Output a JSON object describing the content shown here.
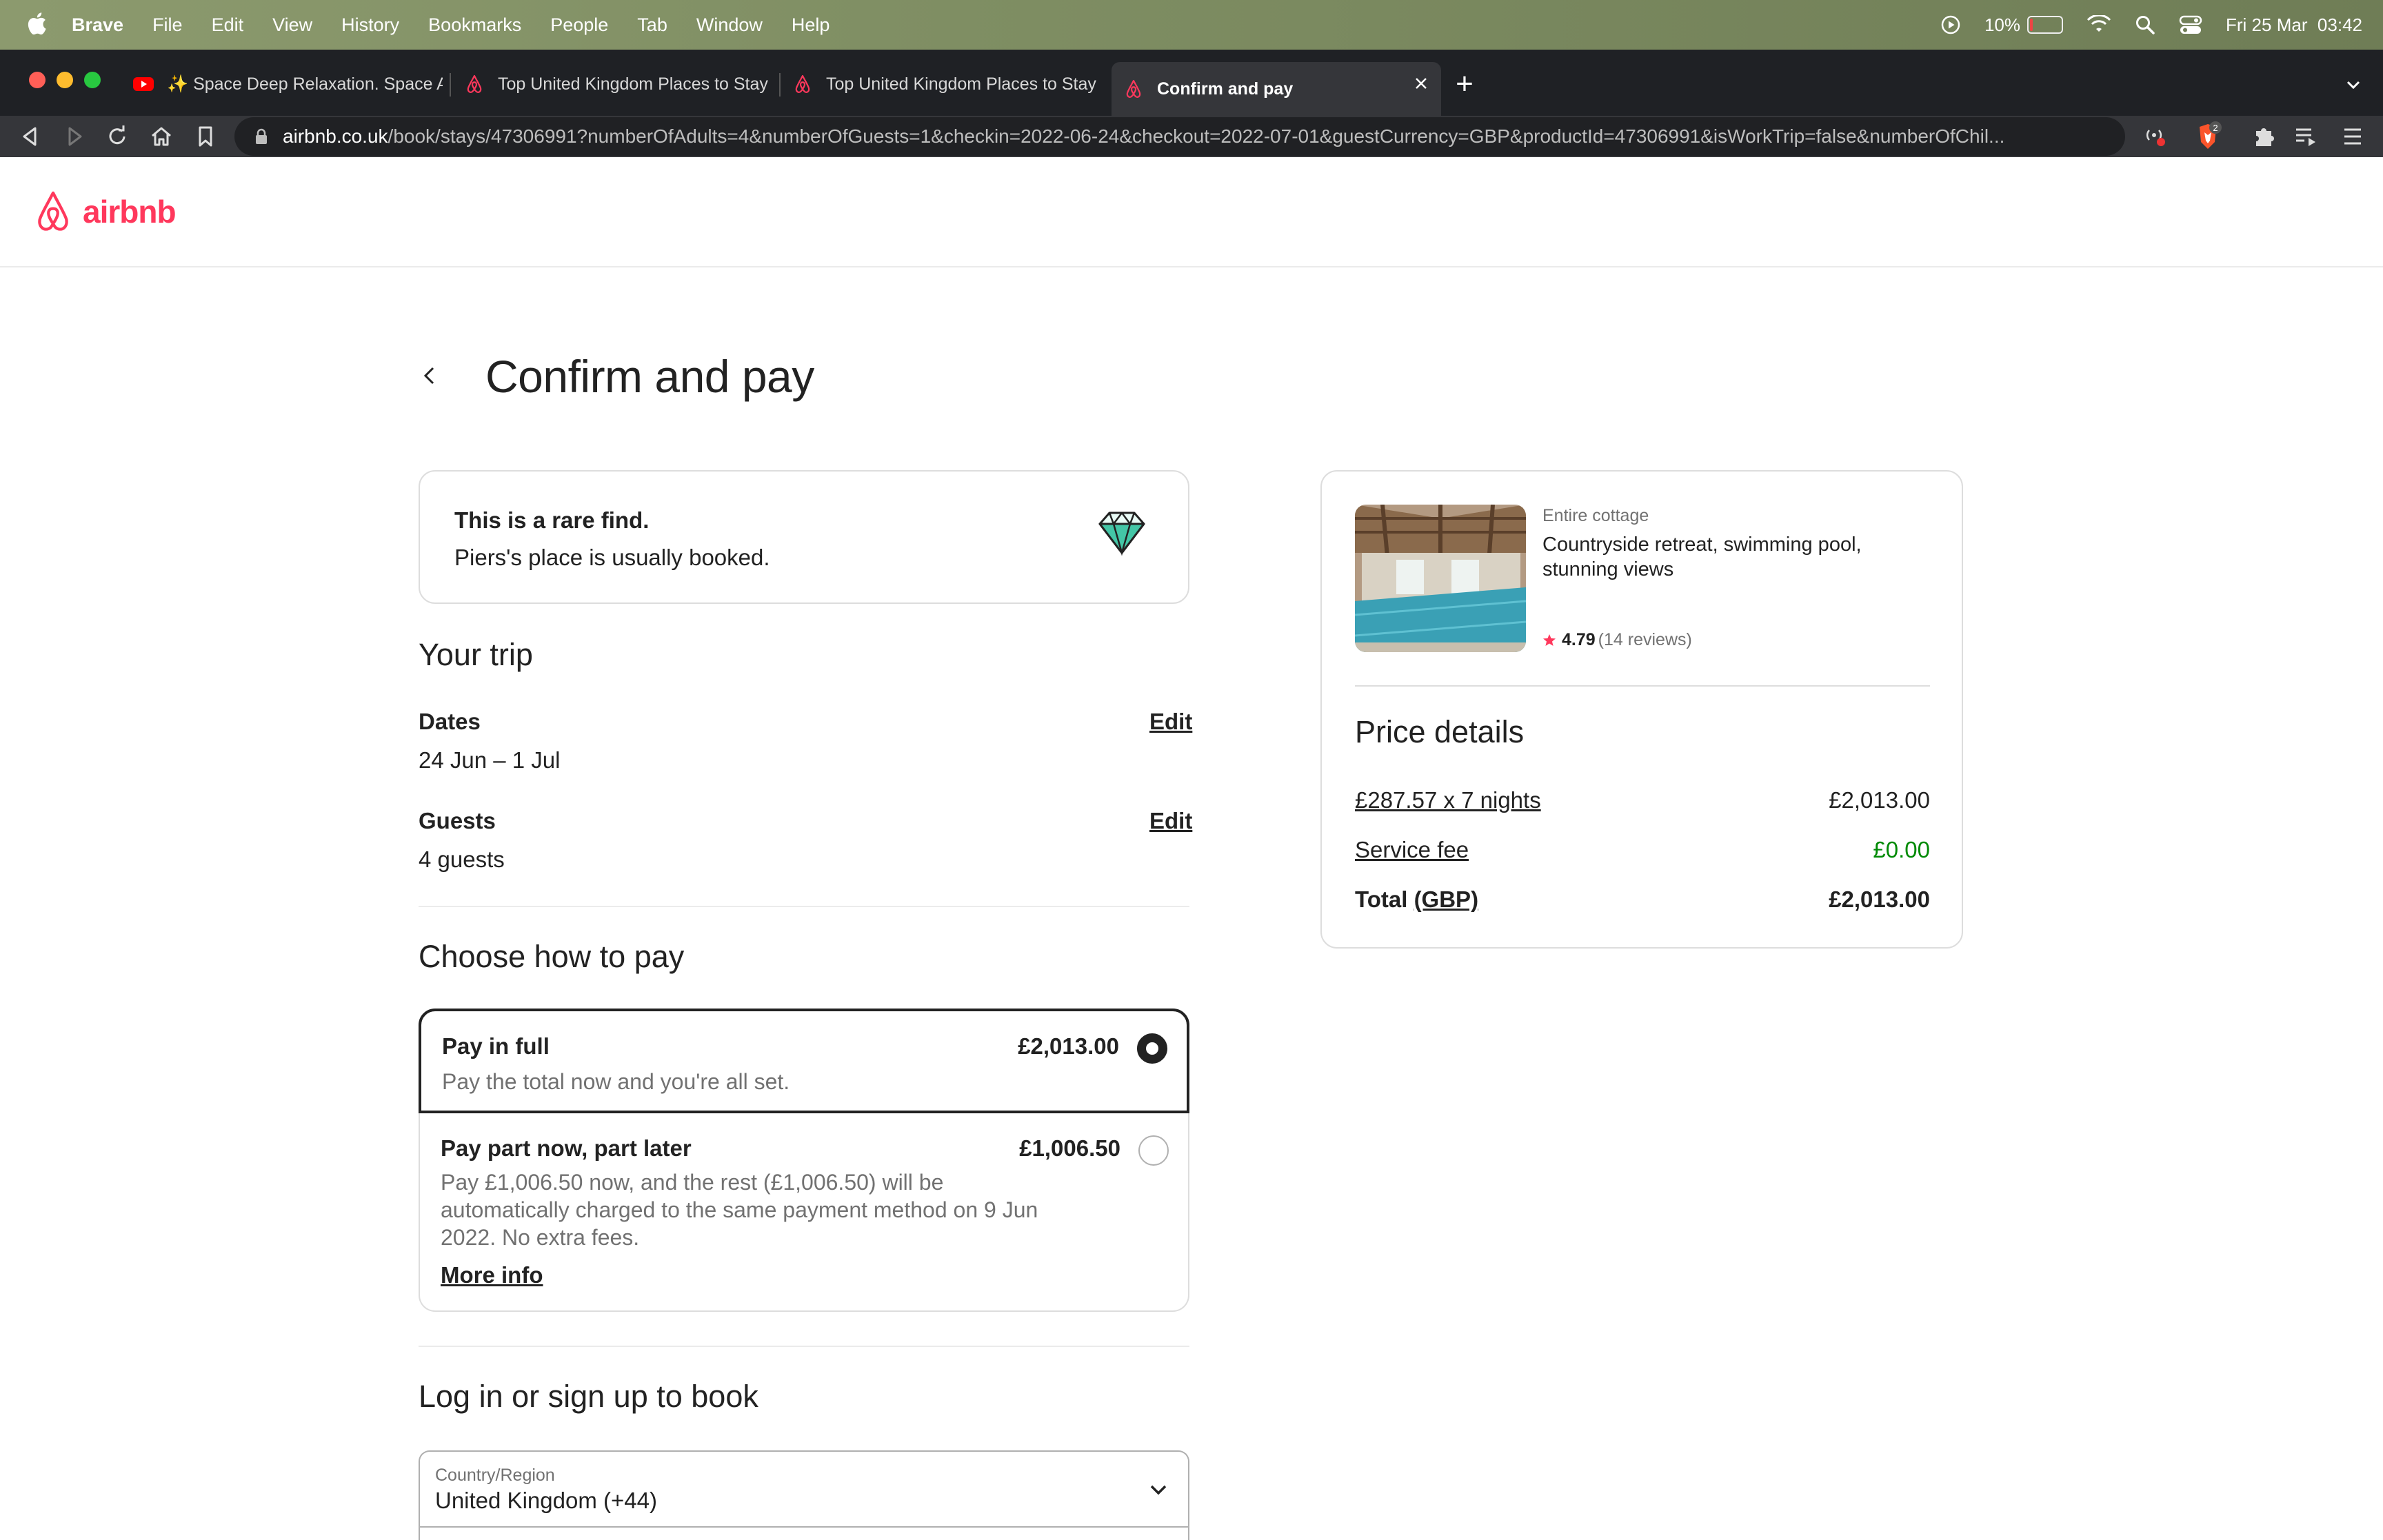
{
  "menubar": {
    "app_name": "Brave",
    "menus": [
      "File",
      "Edit",
      "View",
      "History",
      "Bookmarks",
      "People",
      "Tab",
      "Window",
      "Help"
    ],
    "battery_percent": "10%",
    "battery_level": 0.1,
    "datetime": "Fri 25 Mar  03:42"
  },
  "browser": {
    "tabs": [
      {
        "title": "✨ Space Deep Relaxation. Space A",
        "icon": "youtube-icon"
      },
      {
        "title": "Top United Kingdom Places to Stay",
        "icon": "airbnb-icon"
      },
      {
        "title": "Top United Kingdom Places to Stay",
        "icon": "airbnb-icon"
      },
      {
        "title": "Confirm and pay",
        "icon": "airbnb-icon"
      }
    ],
    "url_host": "airbnb.co.uk",
    "url_path": "/book/stays/47306991?numberOfAdults=4&numberOfGuests=1&checkin=2022-06-24&checkout=2022-07-01&guestCurrency=GBP&productId=47306991&isWorkTrip=false&numberOfChil...",
    "shield_count": "2"
  },
  "site": {
    "logo_text": "airbnb",
    "brand_color": "#ff385c"
  },
  "page": {
    "title": "Confirm and pay",
    "rare": {
      "title": "This is a rare find.",
      "subtitle": "Piers's place is usually booked."
    },
    "trip": {
      "heading": "Your trip",
      "dates_label": "Dates",
      "dates_value": "24 Jun – 1 Jul",
      "guests_label": "Guests",
      "guests_value": "4 guests",
      "edit_label": "Edit"
    },
    "pay": {
      "heading": "Choose how to pay",
      "full": {
        "title": "Pay in full",
        "price": "£2,013.00",
        "desc": "Pay the total now and you're all set.",
        "selected": true
      },
      "part": {
        "title": "Pay part now, part later",
        "price": "£1,006.50",
        "desc": "Pay £1,006.50 now, and the rest (£1,006.50) will be automatically charged to the same payment method on 9 Jun 2022. No extra fees.",
        "more": "More info",
        "selected": false
      }
    },
    "login": {
      "heading": "Log in or sign up to book",
      "country_label": "Country/Region",
      "country_value": "United Kingdom (+44)"
    }
  },
  "listing": {
    "type": "Entire cottage",
    "name": "Countryside retreat, swimming pool, stunning views",
    "rating": "4.79",
    "reviews": "(14 reviews)",
    "price_details": {
      "heading": "Price details",
      "nights_label": "£287.57 x 7 nights",
      "nights_value": "£2,013.00",
      "fee_label": "Service fee",
      "fee_value": "£0.00",
      "total_label": "Total",
      "total_currency": "(GBP)",
      "total_value": "£2,013.00"
    }
  }
}
